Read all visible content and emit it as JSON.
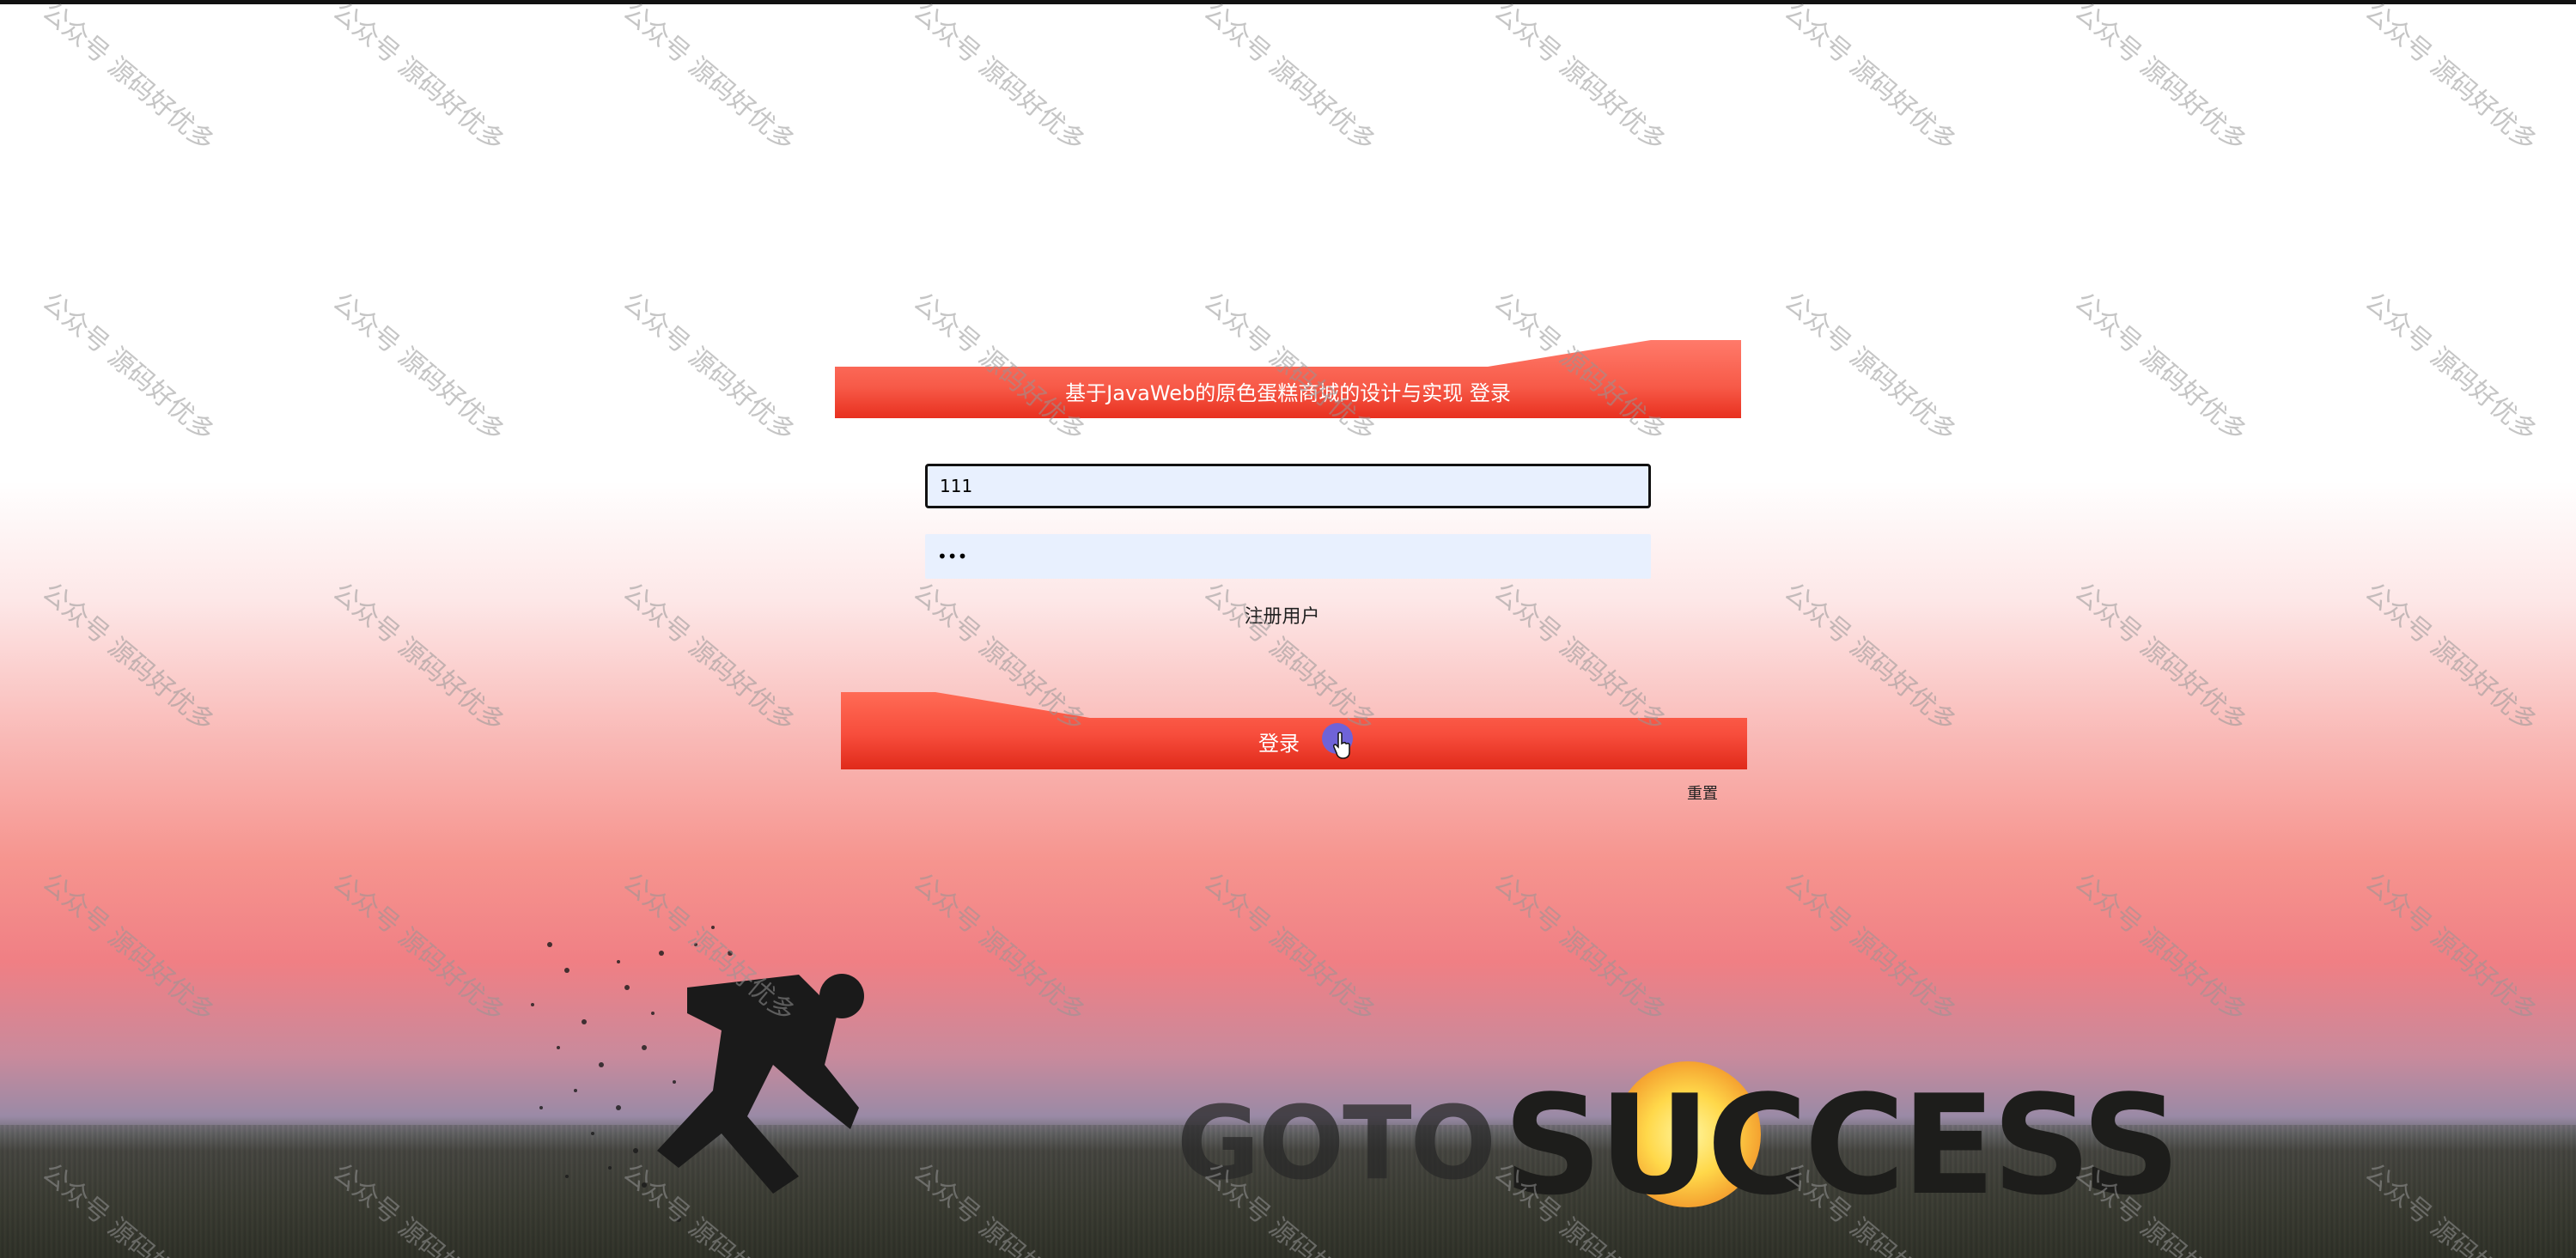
{
  "header": {
    "title": "基于JavaWeb的原色蛋糕商城的设计与实现 登录"
  },
  "form": {
    "username_value": "111",
    "password_value": "•••",
    "register_label": "注册用户",
    "login_label": "登录",
    "reset_label": "重置"
  },
  "background": {
    "poster_text_goto": "GOTO",
    "poster_text_success": "SUCCESS"
  },
  "watermark": {
    "text": "公众号 源码好优多"
  },
  "colors": {
    "banner_red": "#f74d3c",
    "banner_light": "#ff7a6a",
    "field_bg": "#e8f0fe",
    "cursor_dot": "#6f63d8"
  }
}
